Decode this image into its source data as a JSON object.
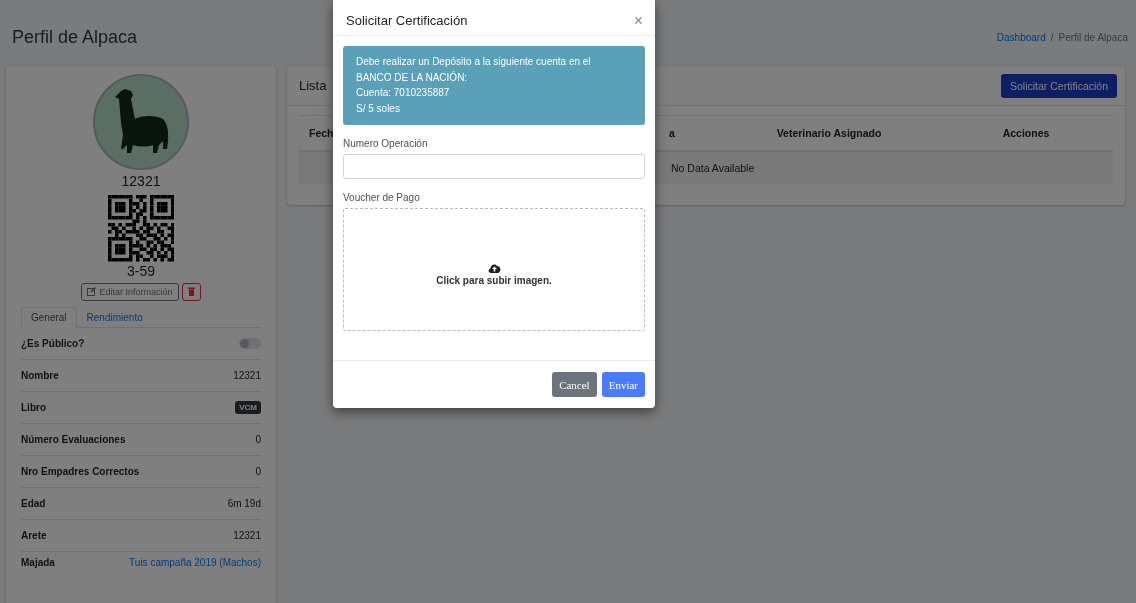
{
  "page": {
    "title": "Perfil de Alpaca",
    "breadcrumb": [
      {
        "kind": "link",
        "label": "Dashboard"
      },
      {
        "kind": "current",
        "label": "Perfil de Alpaca"
      }
    ],
    "separator": "/"
  },
  "profile": {
    "name": "12321",
    "code": "3-59",
    "edit_button": "Editar Información",
    "tabs": [
      {
        "label": "General",
        "selected": true
      },
      {
        "label": "Rendimiento",
        "selected": false
      }
    ],
    "fields": [
      {
        "kind": "toggle",
        "label": "¿Es Público?",
        "on": false
      },
      {
        "kind": "text",
        "label": "Nombre",
        "value": "12321"
      },
      {
        "kind": "badge",
        "label": "Libro",
        "value": "VCM"
      },
      {
        "kind": "text",
        "label": "Número Evaluaciones",
        "value": "0"
      },
      {
        "kind": "text",
        "label": "Nro Empadres Correctos",
        "value": "0"
      },
      {
        "kind": "text",
        "label": "Edad",
        "value": "6m 19d"
      },
      {
        "kind": "text",
        "label": "Arete",
        "value": "12321"
      },
      {
        "kind": "link",
        "label": "Majada",
        "value": "Tuis campaña 2019 (Machos)"
      }
    ]
  },
  "list_card": {
    "title": "Lista",
    "action_button": "Solicitar Certificación",
    "columns": [
      "Fech",
      "a",
      "Veterinario Asignado",
      "Acciones"
    ],
    "empty_message": "No Data Available"
  },
  "modal": {
    "title": "Solicitar Certificación",
    "close": "×",
    "alert_lines": [
      "Debe realizar un Depósito a la siguiente cuenta en el",
      "BANCO DE LA NACIÓN:",
      "Cuenta: 7010235887",
      "S/ 5 soles"
    ],
    "operation_label": "Numero Operación",
    "voucher_label": "Voucher de Pago",
    "upload_text": "Click para subir imagen.",
    "buttons": [
      {
        "kind": "secondary",
        "label": "Cancel"
      },
      {
        "kind": "primary",
        "label": "Enviar"
      }
    ]
  }
}
